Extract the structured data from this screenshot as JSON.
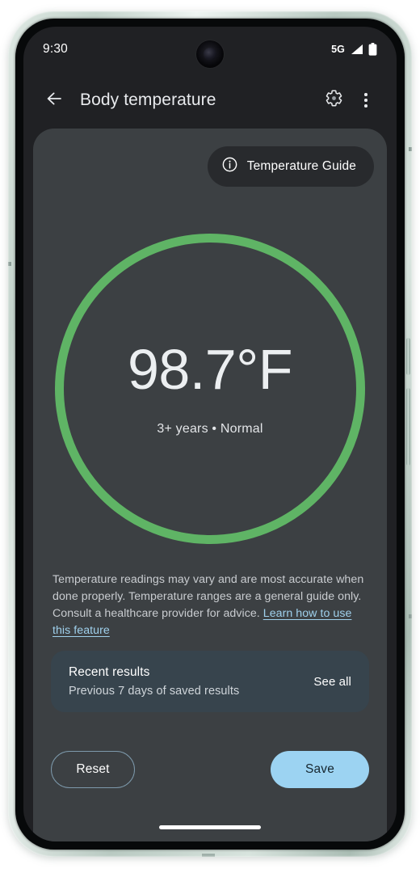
{
  "status_bar": {
    "time": "9:30",
    "network": "5G",
    "signal_icon": "signal-bars-icon",
    "battery_icon": "battery-full-icon"
  },
  "app_bar": {
    "back_icon": "arrow-back-icon",
    "title": "Body temperature",
    "settings_icon": "gear-icon",
    "overflow_icon": "more-vertical-icon"
  },
  "guide_chip": {
    "icon": "info-circle-icon",
    "label": "Temperature Guide"
  },
  "reading": {
    "value": "98.7°F",
    "subtitle": "3+ years • Normal",
    "ring_color": "#5fb465",
    "status": "Normal"
  },
  "disclaimer": {
    "text": "Temperature readings may vary and are most accurate when done properly. Temperature ranges are a general guide only. Consult a healthcare provider for advice. ",
    "link_text": "Learn how to use this feature",
    "link_color": "#9fd0ec"
  },
  "recent_results": {
    "title": "Recent results",
    "subtitle": "Previous 7 days of saved results",
    "see_all_label": "See all",
    "card_color": "#37444d"
  },
  "actions": {
    "reset_label": "Reset",
    "save_label": "Save",
    "save_color": "#9cd3f2"
  },
  "system": {
    "nav_pill": "gesture-nav-pill"
  },
  "theme": {
    "app_bar_bg": "#202124",
    "panel_bg": "#3c4043",
    "chip_bg": "#282a2d",
    "text_primary": "#e8eaed",
    "frame_color": "#c3d3cb"
  }
}
